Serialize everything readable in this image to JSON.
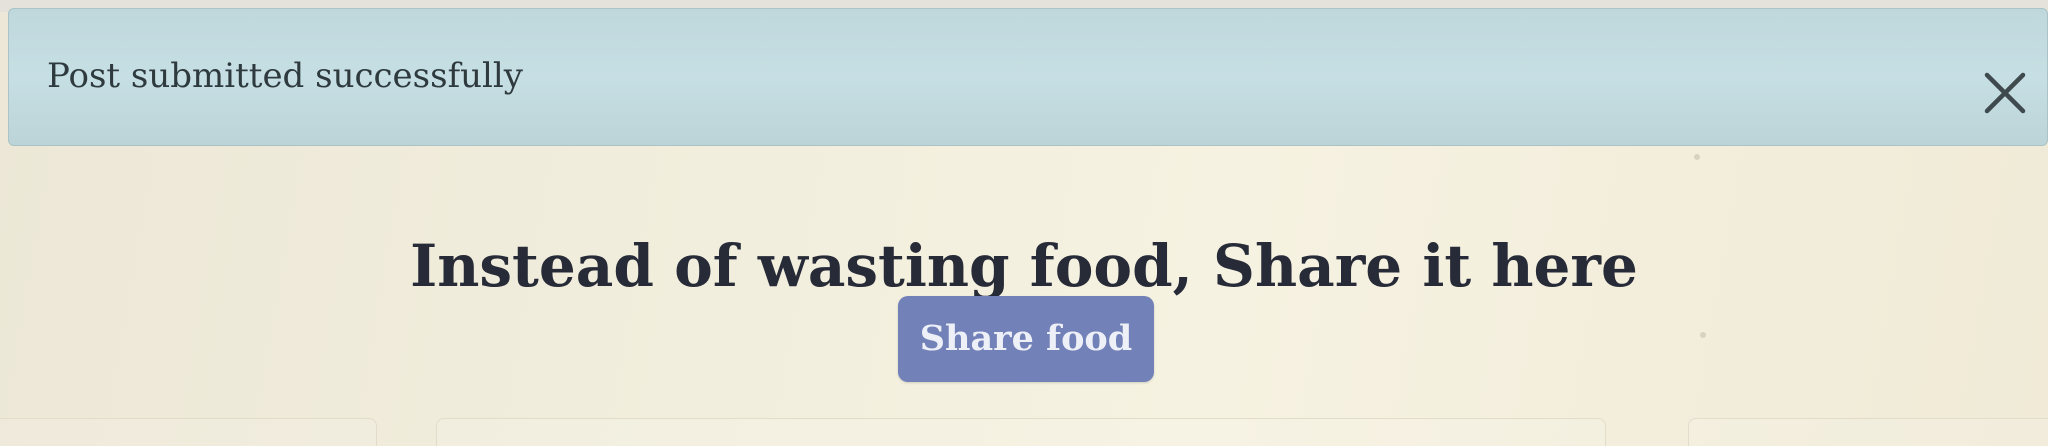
{
  "alert": {
    "message": "Post submitted successfully",
    "close_icon": "close-icon"
  },
  "hero": {
    "headline": "Instead of wasting food, Share it here",
    "share_button_label": "Share food"
  },
  "colors": {
    "alert_background": "#c3dce0",
    "button_background": "#7281b8",
    "page_background": "#f1eddc",
    "headline_text": "#272b38"
  }
}
